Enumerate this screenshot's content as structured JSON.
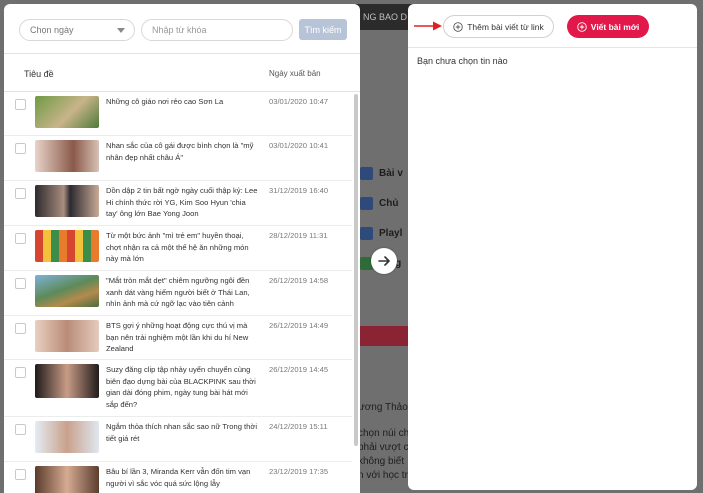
{
  "background": {
    "topbar_text": "NG BAO D",
    "menu_items": [
      "Bài v",
      "Chủ",
      "Playl",
      "Blog"
    ],
    "text_fragments": [
      "ương Thảo",
      "chọn núi cho",
      "phải vượt c",
      "không biết",
      "n với học tr"
    ]
  },
  "filter": {
    "date_placeholder": "Chọn ngày",
    "keyword_placeholder": "Nhập từ khóa",
    "search_label": "Tìm kiếm"
  },
  "table": {
    "col_title": "Tiêu đề",
    "col_date": "Ngày xuất bản",
    "rows": [
      {
        "title": "Những cô giáo nơi rẻo cao Sơn La",
        "date": "03/01/2020 10:47"
      },
      {
        "title": "Nhan sắc của cô gái được bình chọn là \"mỹ nhân đẹp nhất châu Á\"",
        "date": "03/01/2020 10:41"
      },
      {
        "title": "Dồn dập 2 tin bất ngờ ngày cuối thập kỷ: Lee Hi chính thức rời YG, Kim Soo Hyun 'chia tay' ông lớn Bae Yong Joon",
        "date": "31/12/2019 16:40"
      },
      {
        "title": "Từ một bức ảnh \"mì trẻ em\" huyền thoại, chợt nhận ra cả một thế hệ ăn những món này mà lớn",
        "date": "28/12/2019 11:31"
      },
      {
        "title": "\"Mắt tròn mắt dẹt\" chiêm ngưỡng ngôi đền xanh dát vàng hiếm người biết ở Thái Lan, nhìn ảnh mà cứ ngỡ lạc vào tiên cảnh",
        "date": "26/12/2019 14:58"
      },
      {
        "title": "BTS gợi ý những hoạt động cực thú vị mà bạn nên trải nghiệm một lần khi du hí New Zealand",
        "date": "26/12/2019 14:49"
      },
      {
        "title": "Suzy đăng clip tập nhảy uyển chuyển cùng biên đạo dựng bài của BLACKPINK sau thời gian dài đóng phim, ngày tung bài hát mới sắp đến?",
        "date": "26/12/2019 14:45"
      },
      {
        "title": "Ngắm thỏa thích nhan sắc sao nữ Trong thời tiết giá rét",
        "date": "24/12/2019 15:11"
      },
      {
        "title": "Bâu bí lần 3, Miranda Kerr vẫn đốn tim vạn người vì sắc vóc quá sức lộng lẫy",
        "date": "23/12/2019 17:35"
      }
    ]
  },
  "right": {
    "add_from_link_label": "Thêm bài viết từ link",
    "new_post_label": "Viết bài mới",
    "empty_message": "Bạn chưa chọn tin nào"
  },
  "colors": {
    "accent_red": "#e3184a",
    "search_button": "#b7c4d8"
  }
}
